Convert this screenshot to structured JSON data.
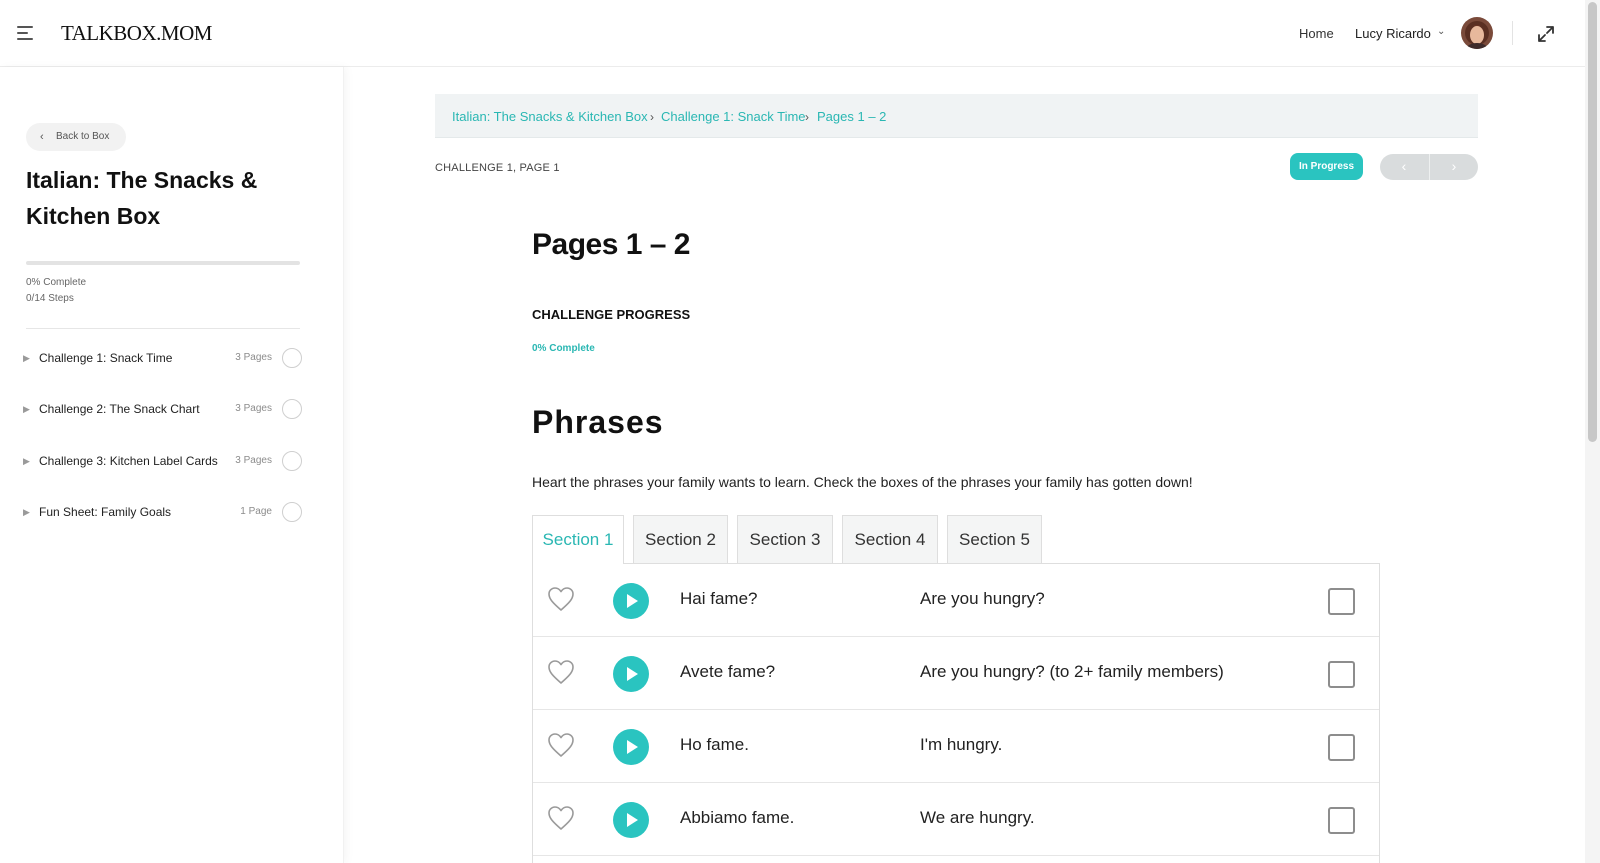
{
  "header": {
    "logo": "TALKBOX.MOM",
    "nav_home": "Home",
    "user_name": "Lucy Ricardo",
    "user_caret": "⌄"
  },
  "sidebar": {
    "back_label": "Back to Box",
    "course_title": "Italian: The Snacks & Kitchen Box",
    "progress_percent": 0,
    "progress_label": "0% Complete",
    "steps_label": "0/14 Steps",
    "lessons": [
      {
        "name": "Challenge 1: Snack Time",
        "count": "3 Pages"
      },
      {
        "name": "Challenge 2: The Snack Chart",
        "count": "3 Pages"
      },
      {
        "name": "Challenge 3: Kitchen Label Cards",
        "count": "3 Pages"
      },
      {
        "name": "Fun Sheet: Family Goals",
        "count": "1 Page"
      }
    ]
  },
  "breadcrumb": {
    "items": [
      "Italian: The Snacks & Kitchen Box",
      "Challenge 1: Snack Time",
      "Pages 1 – 2"
    ],
    "separator": "›"
  },
  "main": {
    "challenge_label": "CHALLENGE 1, PAGE 1",
    "status": "In Progress",
    "prev_symbol": "‹",
    "next_symbol": "›",
    "page_title": "Pages 1 – 2",
    "progress_heading": "CHALLENGE PROGRESS",
    "progress_percent_label": "0% Complete",
    "phrases_title": "Phrases",
    "intro": "Heart the phrases your family wants to learn. Check the boxes of the phrases your family has gotten down!",
    "tabs": [
      "Section 1",
      "Section 2",
      "Section 3",
      "Section 4",
      "Section 5"
    ],
    "active_tab": 0,
    "phrases": [
      {
        "italian": "Hai fame?",
        "english": "Are you hungry?"
      },
      {
        "italian": "Avete fame?",
        "english": "Are you hungry? (to 2+ family members)"
      },
      {
        "italian": "Ho fame.",
        "english": "I'm hungry."
      },
      {
        "italian": "Abbiamo fame.",
        "english": "We are hungry."
      }
    ]
  },
  "colors": {
    "accent": "#2ac4c0",
    "link": "#2ab7b3",
    "crumb_bg": "#f0f3f4",
    "pager_bg": "#d9dcdd"
  },
  "icons": {
    "menu": "hamburger-icon",
    "expand": "expand-icon",
    "back": "chevron-left-icon",
    "heart": "heart-outline-icon",
    "play": "play-icon"
  }
}
